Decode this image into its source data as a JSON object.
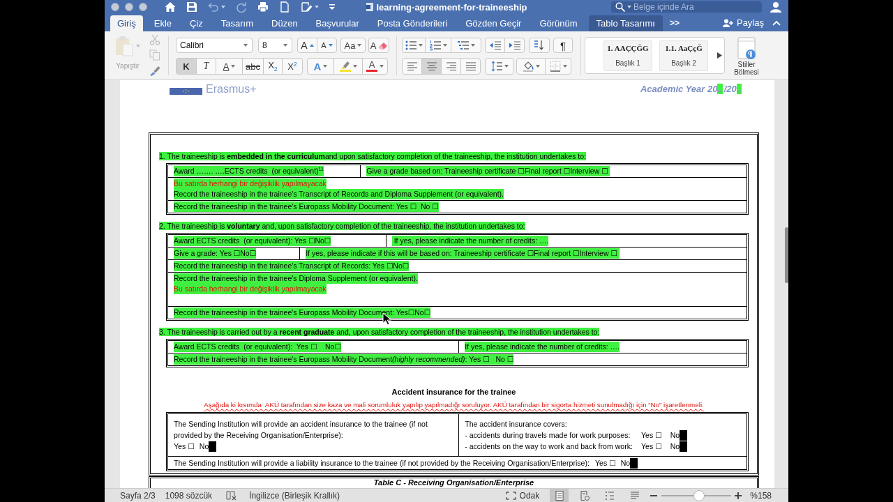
{
  "window": {
    "title": "learning-agreement-for-traineeship",
    "search": {
      "placeholder": "Belge içinde Ara"
    }
  },
  "ribbon_tabs": [
    {
      "label": "Giriş",
      "selected": true,
      "kind": "standard"
    },
    {
      "label": "Ekle",
      "selected": false,
      "kind": "standard"
    },
    {
      "label": "Çiz",
      "selected": false,
      "kind": "standard"
    },
    {
      "label": "Tasarım",
      "selected": false,
      "kind": "standard"
    },
    {
      "label": "Düzen",
      "selected": false,
      "kind": "standard"
    },
    {
      "label": "Başvurular",
      "selected": false,
      "kind": "standard"
    },
    {
      "label": "Posta Gönderileri",
      "selected": false,
      "kind": "standard"
    },
    {
      "label": "Gözden Geçir",
      "selected": false,
      "kind": "standard"
    },
    {
      "label": "Görünüm",
      "selected": false,
      "kind": "standard"
    },
    {
      "label": "Tablo Tasarımı",
      "selected": false,
      "kind": "contextual"
    }
  ],
  "tabs_overflow": ">>",
  "share": {
    "label": "Paylaş"
  },
  "clipboard": {
    "paste_label": "Yapıştır",
    "disabled": true
  },
  "font": {
    "family": "Calibri",
    "size": "8",
    "grow_label": "A",
    "shrink_label": "A",
    "case_label": "Aa",
    "clear_label": "A"
  },
  "format_buttons": [
    {
      "kind": "bold",
      "label": "K",
      "on": true
    },
    {
      "kind": "italic",
      "label": "T",
      "on": false
    },
    {
      "kind": "underline",
      "label": "A",
      "on": false
    },
    {
      "kind": "strikethrough",
      "label": "abc",
      "on": false
    },
    {
      "kind": "subscript",
      "label": "X$_{2}$",
      "on": false
    },
    {
      "kind": "superscript",
      "label": "X$^{2}$",
      "on": false
    }
  ],
  "color_buttons": [
    {
      "kind": "effects",
      "label": "A"
    },
    {
      "kind": "highlight",
      "color": "#f3e332"
    },
    {
      "kind": "font_color",
      "label": "A",
      "color": "#e8262d"
    }
  ],
  "paragraph": {
    "marks_label": "¶",
    "alignment": [
      {
        "kind": "left",
        "selected": false
      },
      {
        "kind": "center",
        "selected": true
      },
      {
        "kind": "right",
        "selected": false
      },
      {
        "kind": "justify",
        "selected": false
      }
    ]
  },
  "styles": [
    {
      "preview": "1. AAÇÇĞG",
      "name": "Başlık 1"
    },
    {
      "preview": "1.1. AaÇçĞ",
      "name": "Başlık 2"
    }
  ],
  "styles_pane": {
    "label": "Stiller Bölmesi"
  },
  "document": {
    "logo_text": "Erasmus+",
    "academic_year": [
      {
        "text": "Academic Year 20",
        "highlighted": false
      },
      {
        "text": "..",
        "highlighted": true
      },
      {
        "text": "/20",
        "highlighted": false
      },
      {
        "text": "..",
        "highlighted": true
      }
    ],
    "sections": [
      {
        "heading": "1. The traineeship is **embedded in the curriculum**and upon satisfactory completion of the traineeship, the institution undertakes to:",
        "highlighted": true,
        "rows": [
          {
            "cells": [
              {
                "lines": [
                  {
                    "kind": "normal",
                    "text": "Award ……. ….ECTS credits  (or equivalent)$^{11}$"
                  }
                ]
              },
              {
                "lines": [
                  {
                    "kind": "normal",
                    "text": "Give a grade based on: Traineeship certificate ☐Final report ☐Interview ☐ "
                  }
                ]
              }
            ]
          },
          {
            "cells": [
              {
                "lines": [
                  {
                    "kind": "note",
                    "text": "Bu satırda herhangi bir değişiklik yapılmayacak"
                  },
                  {
                    "kind": "normal",
                    "text": "Record the traineeship in the trainee's Transcript of Records and Diploma Supplement (or equivalent)."
                  }
                ]
              }
            ]
          },
          {
            "cells": [
              {
                "lines": [
                  {
                    "kind": "normal",
                    "text": "Record the traineeship in the trainee's Europass Mobility Document: Yes ☐  No ☐"
                  }
                ]
              }
            ]
          }
        ]
      },
      {
        "heading": "2. The traineeship is **voluntary** and, upon satisfactory completion of the traineeship, the institution undertakes to:",
        "highlighted": true,
        "rows": [
          {
            "cells": [
              {
                "lines": [
                  {
                    "kind": "normal",
                    "text": "Award ECTS credits  (or equivalent): Yes ☐No☐"
                  }
                ]
              },
              {
                "lines": [
                  {
                    "kind": "normal",
                    "text": " If yes, please indicate the number of credits: …."
                  }
                ]
              }
            ]
          },
          {
            "cells": [
              {
                "lines": [
                  {
                    "kind": "normal",
                    "text": "Give a grade: Yes ☐No☐"
                  }
                ]
              },
              {
                "lines": [
                  {
                    "kind": "normal",
                    "text": "If yes, please indicate if this will be based on: Traineeship certificate ☐Final report ☐Interview ☐ "
                  }
                ]
              }
            ]
          },
          {
            "cells": [
              {
                "lines": [
                  {
                    "kind": "normal",
                    "text": "Record the traineeship in the trainee's Transcript of Records: Yes ☐No☐"
                  }
                ]
              }
            ]
          },
          {
            "cells": [
              {
                "lines": [
                  {
                    "kind": "normal",
                    "text": "Record the traineeship in the trainee's Diploma Supplement (or equivalent)."
                  },
                  {
                    "kind": "note",
                    "text": "Bu satırda herhangi bir değişiklik yapılmayacak"
                  }
                ]
              }
            ]
          },
          {
            "cells": [
              {
                "lines": [
                  {
                    "kind": "normal",
                    "text": "Record the traineeship in the trainee's Europass Mobility Document: Yes☐No☐"
                  }
                ]
              }
            ]
          }
        ]
      },
      {
        "heading": "3. The traineeship is carried out by a **recent graduate** and, upon satisfactory completion of the traineeship, the institution undertakes to:",
        "highlighted": true,
        "rows": [
          {
            "cells": [
              {
                "lines": [
                  {
                    "kind": "normal",
                    "text": "Award ECTS credits  (or equivalent):  Yes ☐    No☐"
                  }
                ]
              },
              {
                "lines": [
                  {
                    "kind": "normal",
                    "text": "If yes, please indicate the number of credits: …."
                  }
                ]
              }
            ]
          },
          {
            "cells": [
              {
                "lines": [
                  {
                    "kind": "normal",
                    "parts": [
                      {
                        "text": "Record the traineeship in the trainee's Europass Mobility Document",
                        "italic": false
                      },
                      {
                        "text": "(highly recommended)",
                        "italic": true
                      },
                      {
                        "text": ": Yes ☐   No ☐",
                        "italic": false
                      }
                    ]
                  }
                ]
              }
            ]
          }
        ]
      }
    ],
    "insurance": {
      "title": "Accident insurance for the trainee",
      "instruction": "Aşağıda ki kısımda  AKÜ tarafından size kaza ve mali sorumluluk yapılıp yapılmadığı soruluyor. AKÜ tarafından bir sigorta hizmeti sunulmadığı için “No” işaretlenmeli.",
      "accident": {
        "text": "The Sending Institution will provide an accident insurance to the trainee (if not provided by the Receiving Organisation/Enterprise):",
        "yes": "Yes ☐",
        "no": "No",
        "no_checked": true
      },
      "covers_title": "The accident insurance covers:",
      "covers": [
        {
          "text": "- accidents during travels made for work purposes:",
          "yes": "Yes ☐",
          "no": "No",
          "no_checked": true
        },
        {
          "text": "- accidents on the way to work and back from work:",
          "yes": "Yes ☐",
          "no": "No",
          "no_checked": true
        }
      ],
      "liability": {
        "text": "The Sending Institution will provide a liability insurance to the trainee (if not provided by the Receiving Organisation/Enterprise):",
        "yes": "Yes ☐",
        "no": "No",
        "no_checked": true
      }
    },
    "next_table_title": "Table C - Receiving Organisation/Enterprise"
  },
  "status_bar": {
    "page": "Sayfa 2/3",
    "words": "1098 sözcük",
    "language": "İngilizce (Birleşik Krallık)",
    "focus_label": "Odak",
    "views": [
      {
        "kind": "print",
        "selected": true
      },
      {
        "kind": "web",
        "selected": false
      },
      {
        "kind": "outline",
        "selected": false
      },
      {
        "kind": "draft",
        "selected": false
      }
    ],
    "zoom": {
      "level": 0.54,
      "label": "%158"
    }
  }
}
